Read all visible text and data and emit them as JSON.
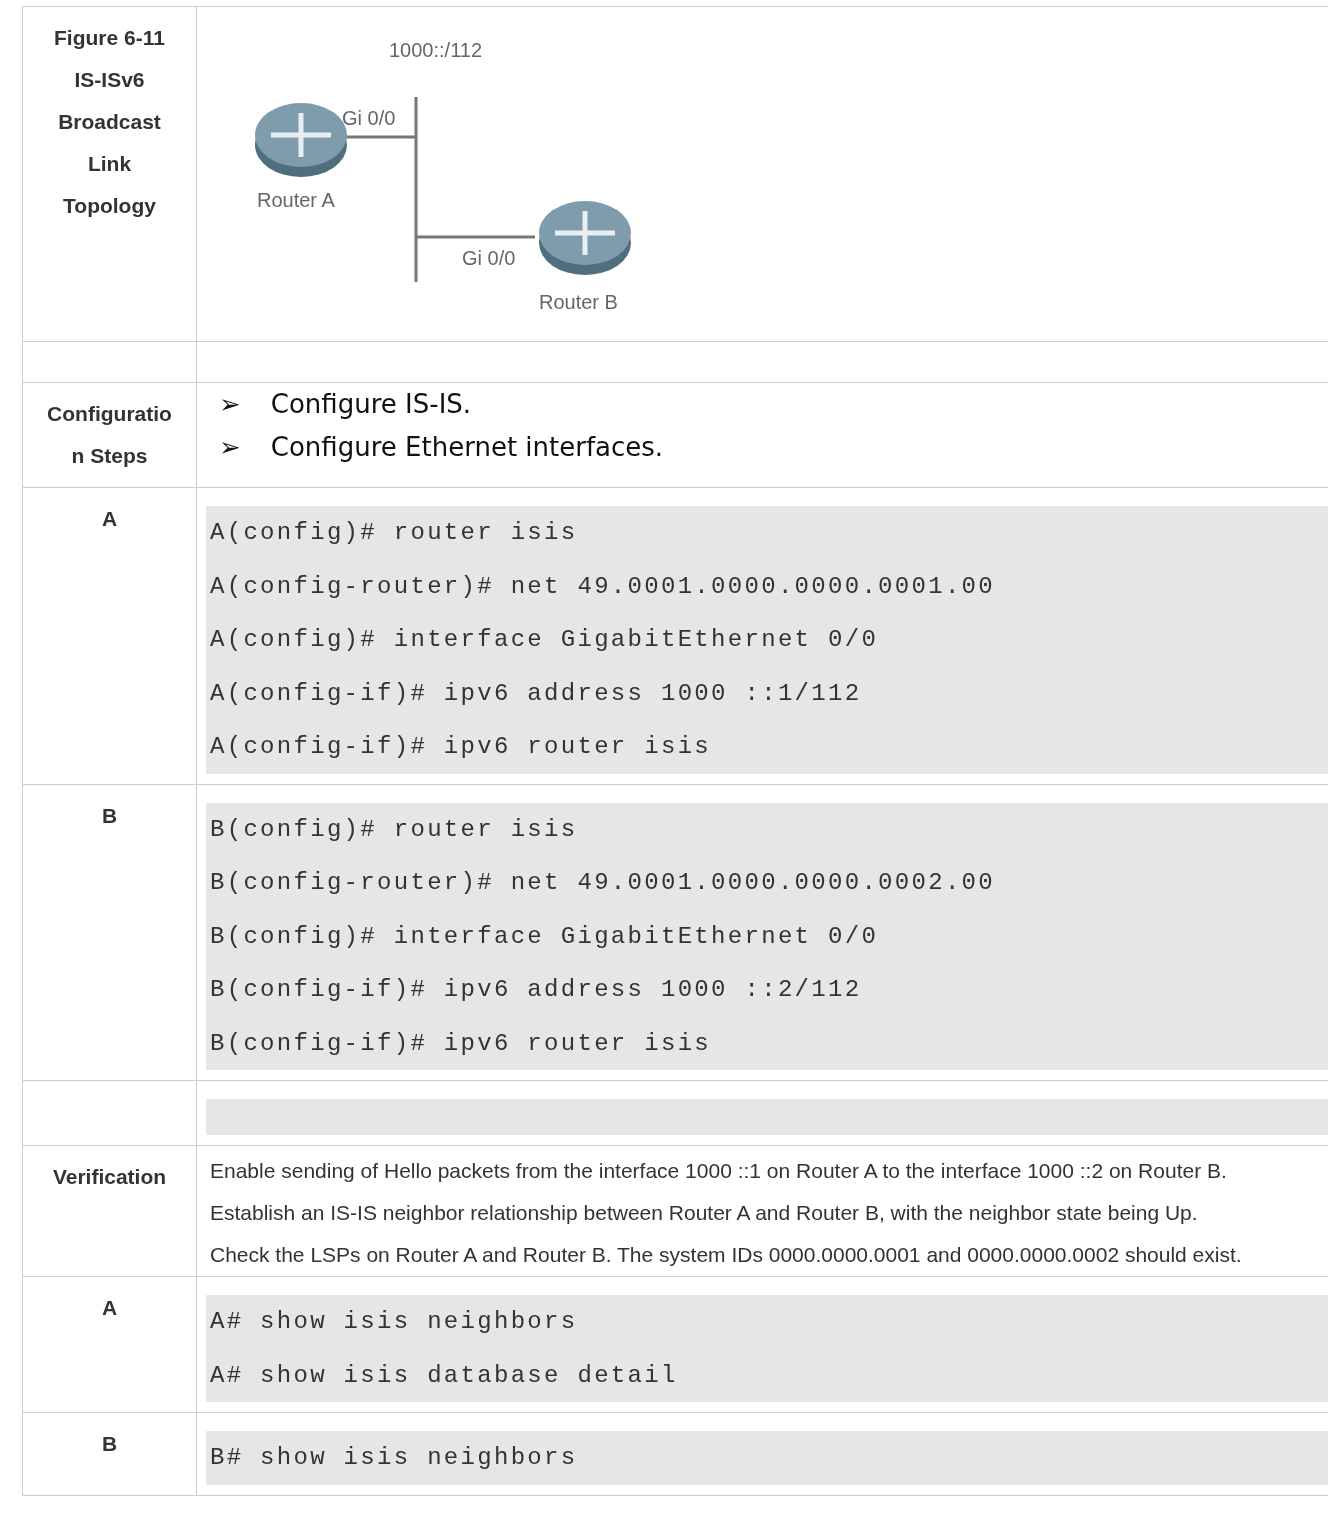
{
  "rows": [
    {
      "kind": "figure",
      "label": "Figure 6-11 IS-ISv6 Broadcast Link Topology",
      "diagram": {
        "subnet": "1000::/112",
        "router_a": {
          "name": "Router A",
          "port": "Gi 0/0"
        },
        "router_b": {
          "name": "Router B",
          "port": "Gi 0/0"
        }
      }
    },
    {
      "kind": "blank"
    },
    {
      "kind": "bullets",
      "label": "Configuration Steps",
      "marker": "➢",
      "items": [
        "Configure IS-IS.",
        "Configure Ethernet interfaces."
      ]
    },
    {
      "kind": "code",
      "label": "A",
      "lines": [
        "A(config)# router isis",
        "A(config-router)# net 49.0001.0000.0000.0001.00",
        "A(config)# interface GigabitEthernet 0/0",
        "A(config-if)# ipv6 address 1000 ::1/112",
        "A(config-if)# ipv6 router isis"
      ]
    },
    {
      "kind": "code",
      "label": "B",
      "lines": [
        "B(config)# router isis",
        "B(config-router)# net 49.0001.0000.0000.0002.00",
        "B(config)# interface GigabitEthernet 0/0",
        "B(config-if)# ipv6 address 1000 ::2/112",
        "B(config-if)# ipv6 router isis"
      ]
    },
    {
      "kind": "code",
      "lines": []
    },
    {
      "kind": "text",
      "label": "Verification",
      "paragraphs": [
        "Enable sending of Hello packets from the interface 1000 ::1 on Router A to the interface 1000 ::2 on Router B.",
        "Establish an IS-IS neighbor relationship between Router A and Router B, with the neighbor state being Up.",
        "Check the LSPs on Router A and Router B. The system IDs 0000.0000.0001 and 0000.0000.0002 should exist."
      ]
    },
    {
      "kind": "code",
      "label": "A",
      "lines": [
        "A# show isis neighbors",
        "A# show isis database detail"
      ]
    },
    {
      "kind": "code",
      "label": "B",
      "lines": [
        "B# show isis neighbors"
      ]
    }
  ]
}
